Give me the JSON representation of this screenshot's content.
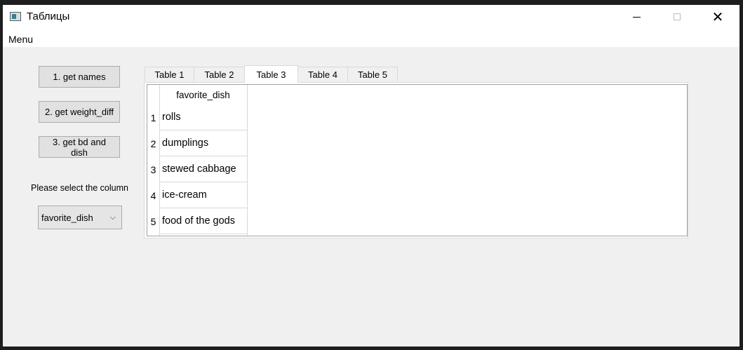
{
  "window": {
    "title": "Таблицы",
    "minimize_icon": "minimize-icon",
    "maximize_icon": "maximize-icon",
    "close_symbol": "✕"
  },
  "menubar": {
    "menu_label": "Menu"
  },
  "sidebar": {
    "buttons": [
      "1. get names",
      "2. get weight_diff",
      "3. get bd and dish"
    ],
    "column_label": "Please select the column",
    "column_select": {
      "value": "favorite_dish",
      "arrow": "⌵"
    }
  },
  "tabs": [
    {
      "label": "Table 1",
      "active": false
    },
    {
      "label": "Table 2",
      "active": false
    },
    {
      "label": "Table 3",
      "active": true
    },
    {
      "label": "Table 4",
      "active": false
    },
    {
      "label": "Table 5",
      "active": false
    }
  ],
  "table": {
    "header": "favorite_dish",
    "rows": [
      {
        "num": "1",
        "value": "rolls"
      },
      {
        "num": "2",
        "value": "dumplings"
      },
      {
        "num": "3",
        "value": "stewed cabbage"
      },
      {
        "num": "4",
        "value": "ice-cream"
      },
      {
        "num": "5",
        "value": "food of the gods"
      }
    ]
  }
}
